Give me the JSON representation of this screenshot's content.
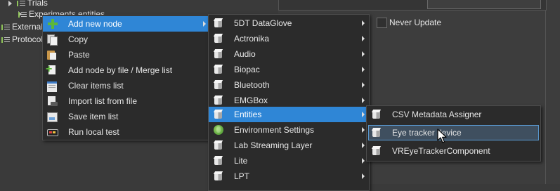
{
  "tree": {
    "items": [
      {
        "label": "Trials"
      },
      {
        "label": "Experiments entities"
      },
      {
        "label": "External"
      },
      {
        "label": "Protocol"
      }
    ]
  },
  "panel": {
    "never_update_label": "Never Update"
  },
  "context_menu": {
    "items": [
      {
        "label": "Add new node",
        "icon": "add-node-icon",
        "has_submenu": true
      },
      {
        "label": "Copy",
        "icon": "copy-icon"
      },
      {
        "label": "Paste",
        "icon": "paste-icon"
      },
      {
        "label": "Add node by file / Merge list",
        "icon": "add-file-icon"
      },
      {
        "label": "Clear items list",
        "icon": "clear-list-icon"
      },
      {
        "label": "Import list from file",
        "icon": "import-icon"
      },
      {
        "label": "Save item list",
        "icon": "save-icon"
      },
      {
        "label": "Run local test",
        "icon": "run-test-icon"
      }
    ]
  },
  "node_menu": {
    "items": [
      {
        "label": "5DT DataGlove",
        "icon": "cube-icon",
        "has_submenu": true
      },
      {
        "label": "Actronika",
        "icon": "cube-icon",
        "has_submenu": true
      },
      {
        "label": "Audio",
        "icon": "cube-icon",
        "has_submenu": true
      },
      {
        "label": "Biopac",
        "icon": "cube-icon",
        "has_submenu": true
      },
      {
        "label": "Bluetooth",
        "icon": "cube-icon",
        "has_submenu": true
      },
      {
        "label": "EMGBox",
        "icon": "cube-icon",
        "has_submenu": true
      },
      {
        "label": "Entities",
        "icon": "cube-icon",
        "has_submenu": true
      },
      {
        "label": "Environment Settings",
        "icon": "globe-icon",
        "has_submenu": true
      },
      {
        "label": "Lab Streaming Layer",
        "icon": "cube-icon",
        "has_submenu": true
      },
      {
        "label": "Lite",
        "icon": "cube-icon",
        "has_submenu": true
      },
      {
        "label": "LPT",
        "icon": "cube-icon",
        "has_submenu": true
      }
    ]
  },
  "entities_menu": {
    "items": [
      {
        "label": "CSV Metadata Assigner",
        "icon": "cube-icon"
      },
      {
        "label": "Eye tracker device",
        "icon": "cube-icon"
      },
      {
        "label": "VREyeTrackerComponent",
        "icon": "cube-icon"
      }
    ]
  },
  "colors": {
    "selection": "#2f86d6",
    "menu_background": "#2b2b2b",
    "window_background": "#3a3a3a"
  }
}
